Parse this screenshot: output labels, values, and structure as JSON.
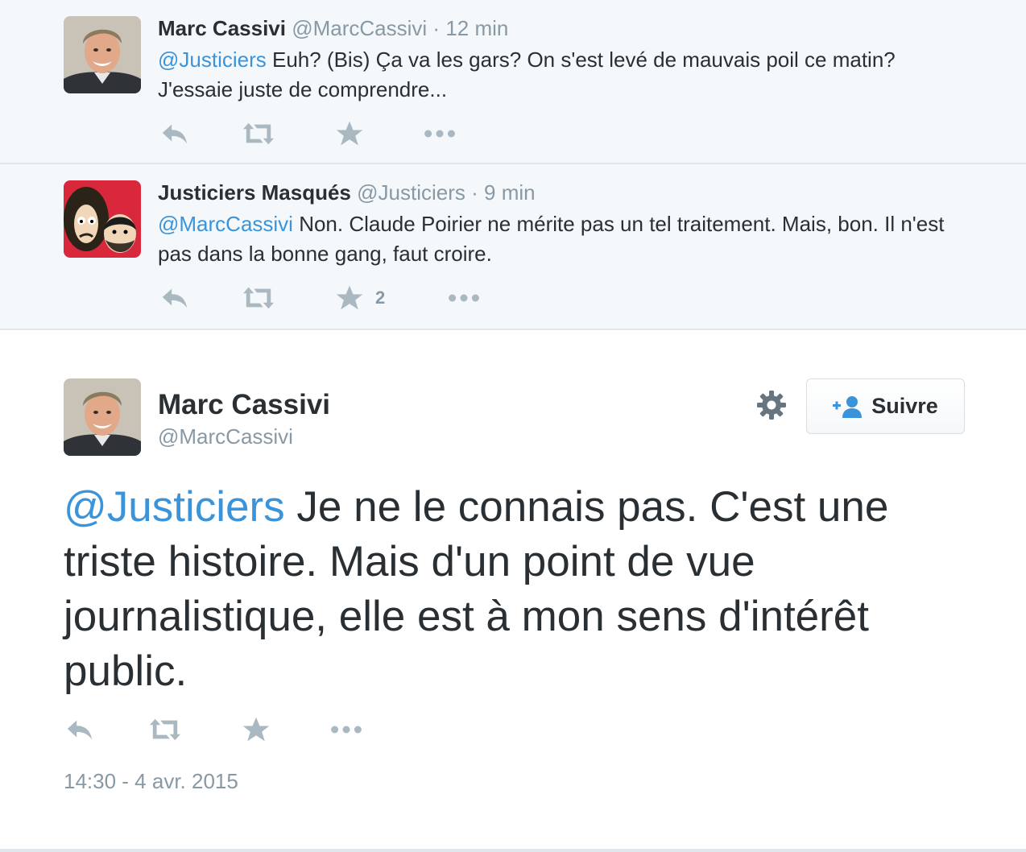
{
  "replies": [
    {
      "fullname": "Marc Cassivi",
      "handle": "@MarcCassivi",
      "separator": "·",
      "time": "12 min",
      "mention": "@Justiciers",
      "text": " Euh? (Bis) Ça va les gars? On s'est levé de mauvais poil ce matin? J'essaie juste de comprendre...",
      "favorite_count": ""
    },
    {
      "fullname": "Justiciers Masqués",
      "handle": "@Justiciers",
      "separator": "·",
      "time": "9 min",
      "mention": "@MarcCassivi",
      "text": " Non. Claude Poirier ne mérite pas un tel traitement. Mais, bon. Il n'est pas dans la bonne gang, faut croire.",
      "favorite_count": "2"
    }
  ],
  "main_tweet": {
    "fullname": "Marc Cassivi",
    "handle": "@MarcCassivi",
    "follow_label": "Suivre",
    "mention": "@Justiciers",
    "text": " Je ne le connais pas. C'est une triste histoire. Mais d'un point de vue journalistique, elle est à mon sens d'intérêt public.",
    "timestamp": "14:30 - 4 avr. 2015"
  },
  "icons": {
    "reply": "reply-icon",
    "retweet": "retweet-icon",
    "favorite": "star-icon",
    "more": "more-dots-icon",
    "settings": "gear-icon",
    "follow": "add-user-icon"
  },
  "colors": {
    "mention": "#3b94d9",
    "muted": "#8899a6",
    "icon": "#aab8c2",
    "reply_background": "#f5f8fa",
    "text": "#292f33"
  }
}
